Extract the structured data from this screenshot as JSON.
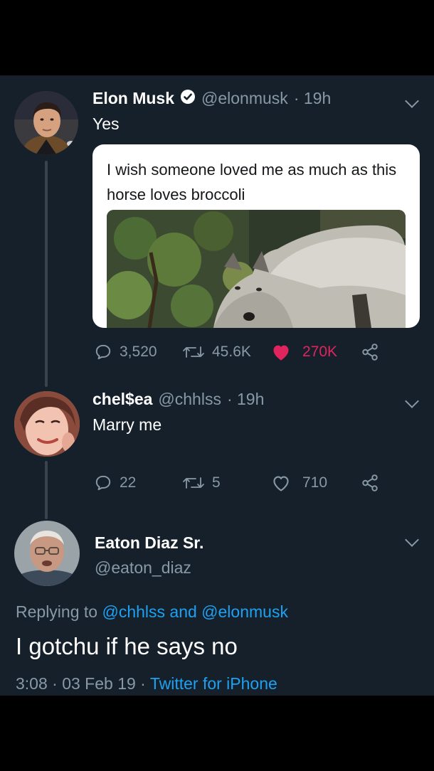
{
  "tweets": [
    {
      "name": "Elon Musk",
      "handle": "@elonmusk",
      "time": "· 19h",
      "text": "Yes",
      "verified": true,
      "quoted": {
        "text": "I wish someone loved me as much as this horse loves broccoli"
      },
      "actions": {
        "replies": "3,520",
        "retweets": "45.6K",
        "likes": "270K",
        "liked": true
      }
    },
    {
      "name": "chel$ea",
      "handle": "@chhlss",
      "time": "· 19h",
      "text": "Marry me",
      "actions": {
        "replies": "22",
        "retweets": "5",
        "likes": "710",
        "liked": false
      }
    }
  ],
  "focus": {
    "name": "Eaton Diaz Sr.",
    "handle": "@eaton_diaz",
    "replying_prefix": "Replying to",
    "replying_user1": "@chhlss",
    "replying_and": "and",
    "replying_user2": "@elonmusk",
    "text": "I gotchu if he says no",
    "timestamp": "3:08 · 03 Feb 19 ·",
    "source": "Twitter for iPhone"
  },
  "colors": {
    "background": "#15202b",
    "accent": "#1da1f2",
    "like": "#e0245e",
    "secondary": "#8899a6"
  },
  "icons": [
    "verified-badge-icon",
    "chevron-down-icon",
    "reply-icon",
    "retweet-icon",
    "like-icon",
    "share-icon"
  ]
}
